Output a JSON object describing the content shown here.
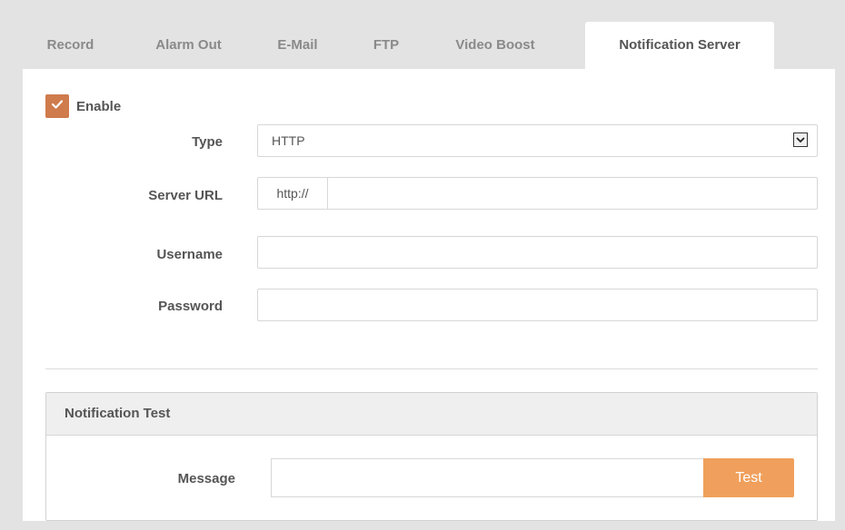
{
  "tabs": [
    {
      "label": "Record"
    },
    {
      "label": "Alarm Out"
    },
    {
      "label": "E-Mail"
    },
    {
      "label": "FTP"
    },
    {
      "label": "Video Boost"
    },
    {
      "label": "Notification Server"
    }
  ],
  "active_tab": "Notification Server",
  "enable": {
    "label": "Enable",
    "checked": true
  },
  "form": {
    "type_label": "Type",
    "type_value": "HTTP",
    "server_url_label": "Server URL",
    "server_url_prefix": "http://",
    "server_url_value": "",
    "username_label": "Username",
    "username_value": "",
    "password_label": "Password",
    "password_value": ""
  },
  "notification_test": {
    "title": "Notification Test",
    "message_label": "Message",
    "message_value": "",
    "test_button": "Test"
  },
  "colors": {
    "accent_checkbox": "#cf7b4c",
    "test_button": "#f0a05c",
    "background": "#e3e3e3"
  },
  "icons": {
    "checkbox": "checkmark-icon",
    "dropdown": "chevron-down-icon"
  }
}
